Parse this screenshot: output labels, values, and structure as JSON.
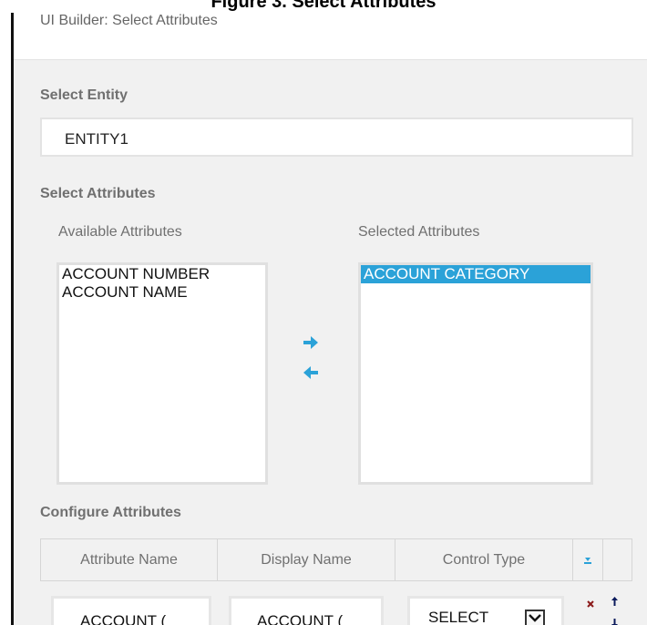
{
  "figure_caption": "Figure 3. Select Attributes",
  "panel": {
    "title": "UI Builder: Select Attributes"
  },
  "entity": {
    "label": "Select Entity",
    "value": "ENTITY1"
  },
  "attributes": {
    "label": "Select Attributes",
    "available": {
      "label": "Available Attributes",
      "items": [
        "ACCOUNT NUMBER",
        "ACCOUNT NAME"
      ]
    },
    "selected": {
      "label": "Selected Attributes",
      "items": [
        "ACCOUNT CATEGORY"
      ]
    },
    "move_right_icon": "arrow-right-icon",
    "move_left_icon": "arrow-left-icon"
  },
  "configure": {
    "label": "Configure Attributes",
    "columns": [
      "Attribute Name",
      "Display Name",
      "Control Type"
    ],
    "header_icon": "download-icon",
    "row": {
      "attribute_name": "ACCOUNT (",
      "display_name": "ACCOUNT (",
      "control_type": "SELECT",
      "dropdown_icon": "chevron-down-icon",
      "delete_icon": "close-icon",
      "move_up_icon": "arrow-up-icon",
      "move_down_icon": "arrow-down-icon"
    }
  },
  "colors": {
    "accent": "#2ba2d8",
    "panel_bg": "#f1f1f1",
    "label_gray": "#707070",
    "delete_red": "#8b1a1a",
    "move_navy": "#0a1a5c"
  }
}
